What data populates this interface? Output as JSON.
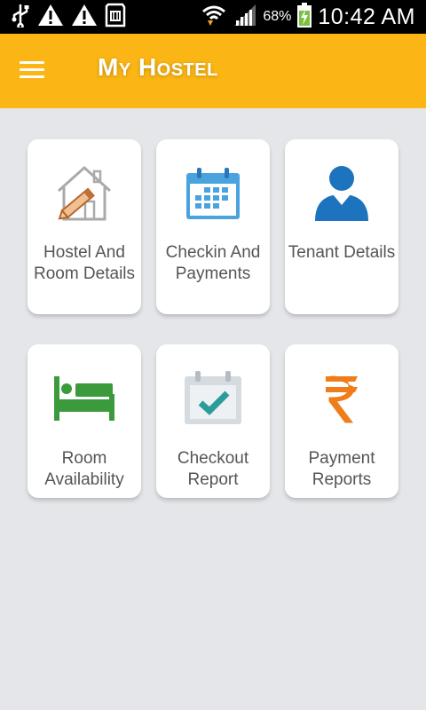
{
  "status_bar": {
    "icons": [
      "usb-icon",
      "warning-icon",
      "warning-icon",
      "sd-card-icon",
      "wifi-icon",
      "signal-icon",
      "battery-charging-icon"
    ],
    "battery_percent": "68%",
    "time": "10:42 AM"
  },
  "app_bar": {
    "title": "My Hostel",
    "menu_icon": "hamburger-menu-icon",
    "color": "#fbb615"
  },
  "tiles": [
    {
      "label": "Hostel And Room Details",
      "icon": "house-pencil-icon"
    },
    {
      "label": "Checkin And Payments",
      "icon": "calendar-icon"
    },
    {
      "label": "Tenant Details",
      "icon": "person-icon"
    },
    {
      "label": "Room Availability",
      "icon": "bed-icon"
    },
    {
      "label": "Checkout Report",
      "icon": "calendar-check-icon"
    },
    {
      "label": "Payment Reports",
      "icon": "rupee-icon"
    }
  ]
}
